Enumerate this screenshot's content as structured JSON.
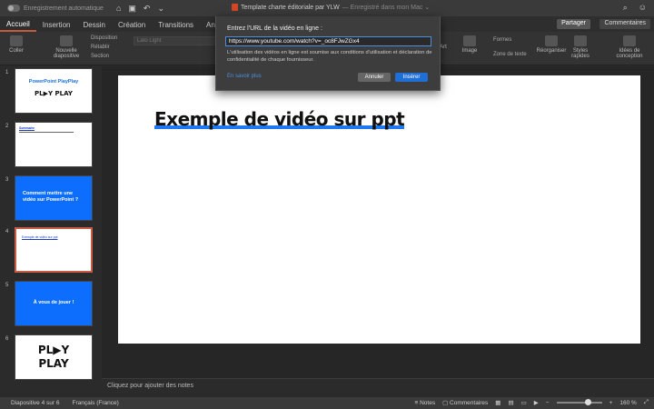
{
  "titlebar": {
    "autosave_label": "Enregistrement automatique",
    "doc_title": "Template charte éditoriale par YLW",
    "doc_subtitle": "— Enregistré dans mon Mac ⌄"
  },
  "tabs": [
    "Accueil",
    "Insertion",
    "Dessin",
    "Création",
    "Transitions",
    "Animations"
  ],
  "header_buttons": {
    "share": "Partager",
    "comments": "Commentaires"
  },
  "ribbon": {
    "paste": "Coller",
    "new_slide": "Nouvelle diapositive",
    "layout": "Disposition",
    "reset": "Rétablir",
    "section": "Section",
    "font": "Lato Light",
    "image": "Image",
    "shapes": "Formes",
    "textbox": "Zone de texte",
    "arrange": "Réorganiser",
    "quick_styles": "Styles rapides",
    "design_ideas": "Idées de conception",
    "art": "Art"
  },
  "thumbnails": [
    {
      "num": "1",
      "title": "PowerPoint PlayPlay",
      "logo": "PL▶Y PLAY"
    },
    {
      "num": "2",
      "title": "Sommaire"
    },
    {
      "num": "3",
      "title": "Comment mettre une vidéo sur PowerPoint ?"
    },
    {
      "num": "4",
      "title": "Exemple de vidéo sur ppt"
    },
    {
      "num": "5",
      "title": "À vous de jouer !"
    },
    {
      "num": "6",
      "logo_top": "PL▶Y",
      "logo_bottom": "PLAY"
    }
  ],
  "slide": {
    "title": "Exemple de vidéo sur ppt"
  },
  "notes_placeholder": "Cliquez pour ajouter des notes",
  "status": {
    "slide_info": "Diapositive 4 sur 6",
    "language": "Français (France)",
    "notes": "Notes",
    "comments": "Commentaires",
    "zoom": "160 %"
  },
  "zoom_level": 0.7,
  "dialog": {
    "prompt": "Entrez l'URL de la vidéo en ligne :",
    "url_value": "https://www.youtube.com/watch?v=_oc8FJwZGx4",
    "note": "L'utilisation des vidéos en ligne est soumise aux conditions d'utilisation et déclaration de confidentialité de chaque fournisseur.",
    "learn_more": "En savoir plus",
    "cancel": "Annuler",
    "insert": "Insérer"
  },
  "colors": {
    "accent": "#c55a3e",
    "primary_button": "#1f6fd6",
    "slide_blue": "#0d6efd",
    "highlight": "#1f78f0"
  }
}
